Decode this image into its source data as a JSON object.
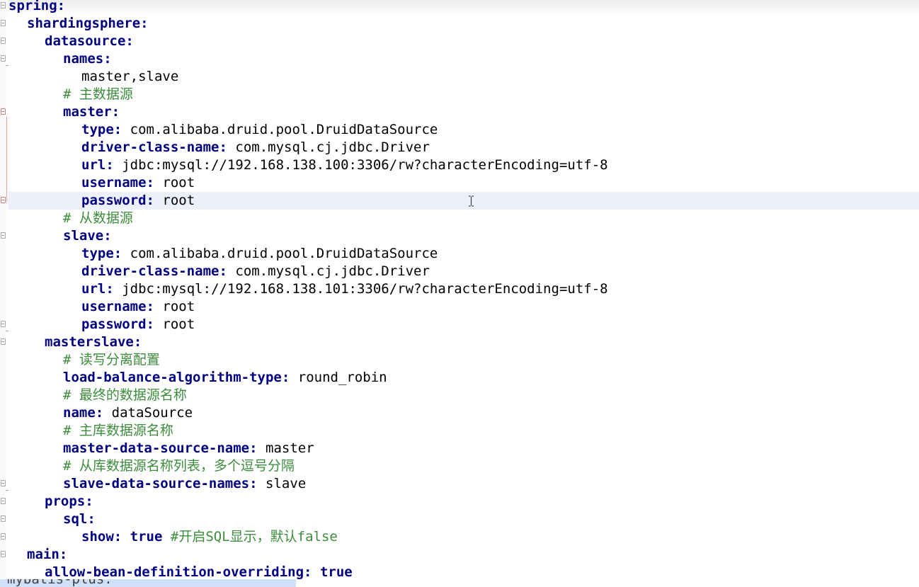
{
  "editor": {
    "lines": [
      {
        "key": "spring",
        "colon": ":"
      },
      {
        "key": "shardingsphere",
        "colon": ":"
      },
      {
        "key": "datasource",
        "colon": ":"
      },
      {
        "key": "names",
        "colon": ":"
      },
      {
        "value": "master,slave"
      },
      {
        "comment": "# 主数据源"
      },
      {
        "key": "master",
        "colon": ":"
      },
      {
        "key": "type",
        "colon": ":",
        "value": "com.alibaba.druid.pool.DruidDataSource"
      },
      {
        "key": "driver-class-name",
        "colon": ":",
        "value": "com.mysql.cj.jdbc.Driver"
      },
      {
        "key": "url",
        "colon": ":",
        "value": "jdbc:mysql://192.168.138.100:3306/rw?characterEncoding=utf-8"
      },
      {
        "key": "username",
        "colon": ":",
        "value": "root"
      },
      {
        "key": "password",
        "colon": ":",
        "value": "root"
      },
      {
        "comment": "# 从数据源"
      },
      {
        "key": "slave",
        "colon": ":"
      },
      {
        "key": "type",
        "colon": ":",
        "value": "com.alibaba.druid.pool.DruidDataSource"
      },
      {
        "key": "driver-class-name",
        "colon": ":",
        "value": "com.mysql.cj.jdbc.Driver"
      },
      {
        "key": "url",
        "colon": ":",
        "value": "jdbc:mysql://192.168.138.101:3306/rw?characterEncoding=utf-8"
      },
      {
        "key": "username",
        "colon": ":",
        "value": "root"
      },
      {
        "key": "password",
        "colon": ":",
        "value": "root"
      },
      {
        "key": "masterslave",
        "colon": ":"
      },
      {
        "comment": "# 读写分离配置"
      },
      {
        "key": "load-balance-algorithm-type",
        "colon": ":",
        "value": "round_robin"
      },
      {
        "comment": "# 最终的数据源名称"
      },
      {
        "key": "name",
        "colon": ":",
        "value": "dataSource"
      },
      {
        "comment": "# 主库数据源名称"
      },
      {
        "key": "master-data-source-name",
        "colon": ":",
        "value": "master"
      },
      {
        "comment": "# 从库数据源名称列表，多个逗号分隔"
      },
      {
        "key": "slave-data-source-names",
        "colon": ":",
        "value": "slave"
      },
      {
        "key": "props",
        "colon": ":"
      },
      {
        "key": "sql",
        "colon": ":"
      },
      {
        "key": "show",
        "colon": ":",
        "bool": "true",
        "comment": "#开启SQL显示，默认false"
      },
      {
        "key": "main",
        "colon": ":"
      },
      {
        "key": "allow-bean-definition-overriding",
        "colon": ":",
        "bool": "true"
      }
    ],
    "partial_line": "mybatis-plus:"
  }
}
